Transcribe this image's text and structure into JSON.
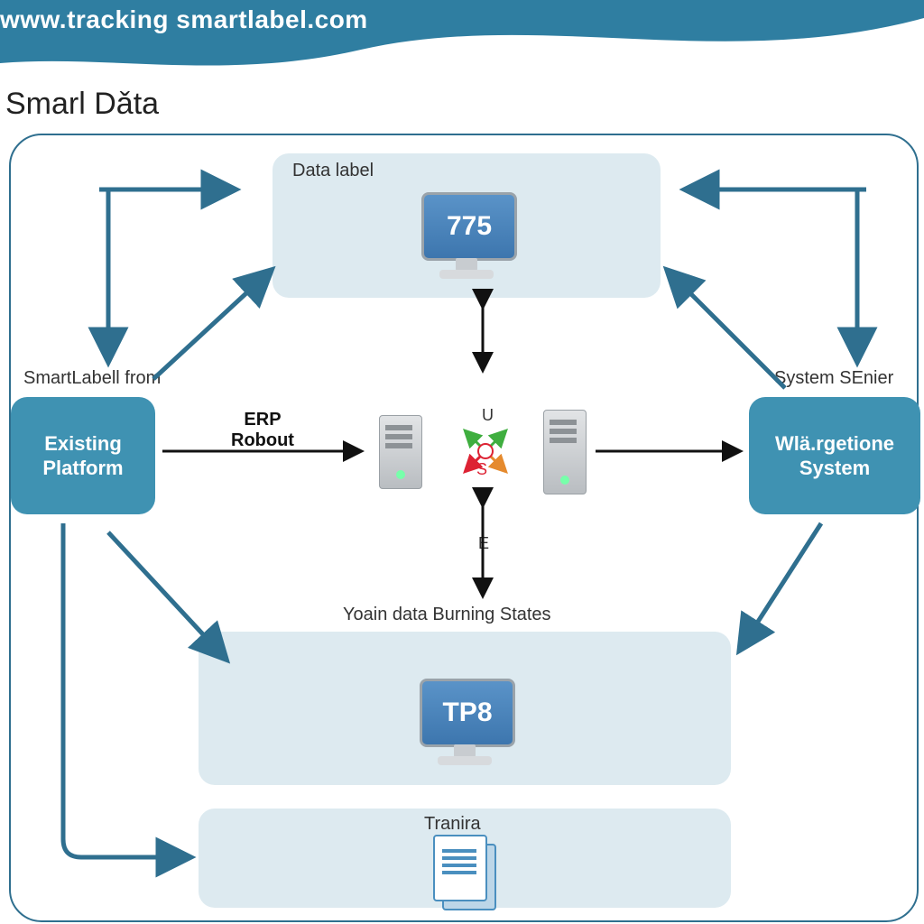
{
  "header": {
    "url": "www.tracking smartlabel.com"
  },
  "title": "Smarl Dǎta",
  "captions": {
    "left": "SmartLabell from",
    "right": "System SEnier",
    "erp_line1": "ERP",
    "erp_line2": "Robout"
  },
  "nodes": {
    "top": {
      "label": "Data label",
      "screen_text": "775"
    },
    "left": {
      "line1": "Existing",
      "line2": "Platform"
    },
    "right": {
      "line1": "Wlä.rgetione",
      "line2": "System"
    },
    "mid": {
      "label": "Yoain data Burning States",
      "screen_text": "TP8"
    },
    "bot": {
      "label": "Tranira"
    }
  },
  "compass": {
    "n": "S",
    "s": "E",
    "u": "U",
    "center": "S"
  },
  "colors": {
    "brand_teal": "#3f92b2",
    "border_teal": "#2f6f8f",
    "pale_panel": "#ddeaf0",
    "arrow_stroke": "#2f6f8f",
    "arrow_black": "#111111"
  }
}
